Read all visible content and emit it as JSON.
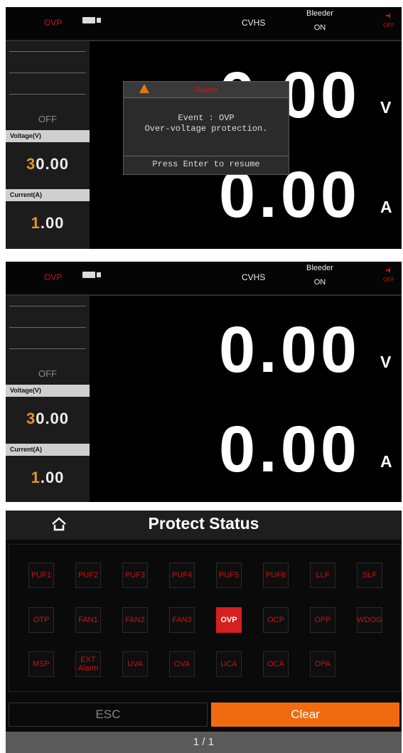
{
  "status_bar": {
    "mode": "OVP",
    "cv": "CVHS",
    "bleeder_label": "Bleeder",
    "bleeder_value": "ON",
    "speaker_state": "OFF"
  },
  "sidebar": {
    "output_state": "OFF",
    "voltage_label": "Voltage(V)",
    "voltage_first_digit": "3",
    "voltage_rest": "0.00",
    "current_label": "Current(A)",
    "current_first_digit": "1",
    "current_rest": ".00"
  },
  "readout": {
    "voltage": "0.00",
    "voltage_unit": "V",
    "current": "0.00",
    "current_unit": "A"
  },
  "alarm_dialog": {
    "title": "Alarm",
    "event_line": "Event : OVP",
    "message_line": "Over-voltage protection.",
    "button": "Press Enter to resume"
  },
  "protect_status": {
    "title": "Protect Status",
    "row1": [
      "PUF1",
      "PUF2",
      "PUF3",
      "PUF4",
      "PUF5",
      "PUF6",
      "LLF",
      "SLF"
    ],
    "row2": [
      "OTP",
      "FAN1",
      "FAN2",
      "FAN3",
      "OVP",
      "OCP",
      "OPP",
      "WDOG"
    ],
    "row3": [
      "MSP",
      "EXT\nAlarm",
      "UVA",
      "OVA",
      "UCA",
      "OCA",
      "OPA"
    ],
    "active_item": "OVP",
    "esc_label": "ESC",
    "clear_label": "Clear",
    "page": "1 / 1"
  },
  "colors": {
    "alarm_red": "#d42020",
    "accent_orange": "#f26a10",
    "digit_highlight": "#e0962a"
  },
  "icons": [
    "usb-icon",
    "speaker-icon",
    "warning-icon",
    "home-icon"
  ]
}
